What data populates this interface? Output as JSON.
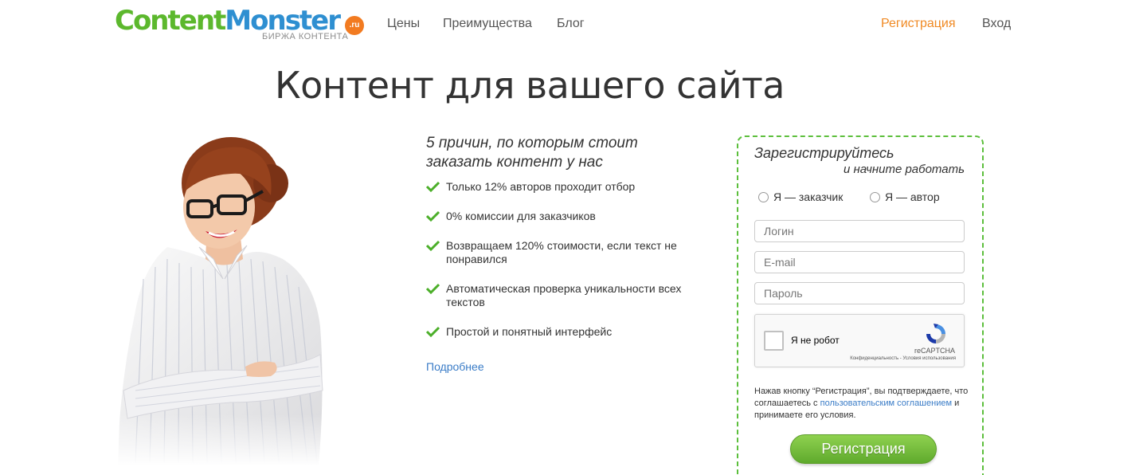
{
  "logo": {
    "word1": "Content",
    "word2": "Monster",
    "badge": ".ru",
    "subtitle": "БИРЖА КОНТЕНТА"
  },
  "nav": {
    "prices": "Цены",
    "advantages": "Преимущества",
    "blog": "Блог",
    "register": "Регистрация",
    "login": "Вход"
  },
  "hero_title": "Контент для вашего сайта",
  "reasons": {
    "title": "5 причин, по которым стоит заказать контент у нас",
    "items": [
      "Только 12% авторов проходит отбор",
      "0% комиссии для заказчиков",
      "Возвращаем 120% стоимости, если текст не понравился",
      "Автоматическая проверка уникальности всех текстов",
      "Простой и понятный интерфейс"
    ],
    "more_link": "Подробнее"
  },
  "registration": {
    "title": "Зарегистрируйтесь",
    "subtitle": "и начните работать",
    "role_customer": "Я — заказчик",
    "role_author": "Я — автор",
    "login_placeholder": "Логин",
    "email_placeholder": "E-mail",
    "password_placeholder": "Пароль",
    "captcha": {
      "label": "Я не робот",
      "brand": "reCAPTCHA",
      "links": "Конфиденциальность - Условия использования"
    },
    "terms_prefix": "Нажав кнопку “Регистрация”, вы подтверждаете, что соглашаетесь с",
    "terms_link": "пользовательским соглашением",
    "terms_suffix": "и принимаете его условия.",
    "button": "Регистрация"
  },
  "colors": {
    "accent_green": "#5cbf3c",
    "logo_blue": "#2e8fd1",
    "nav_orange": "#f08a24",
    "link_blue": "#3a7cc7"
  }
}
